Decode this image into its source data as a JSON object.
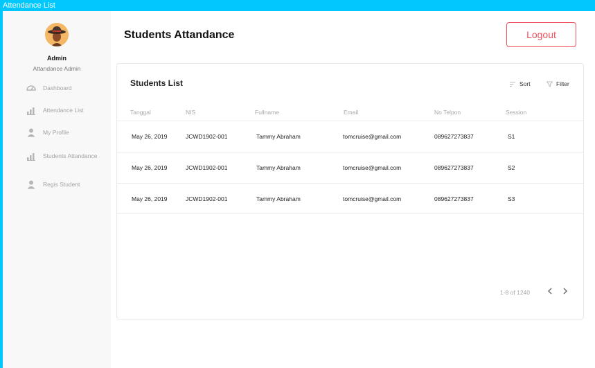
{
  "window": {
    "title": "Attendance List"
  },
  "sidebar": {
    "user": {
      "name": "Admin",
      "role": "Attandance Admin"
    },
    "items": [
      {
        "label": "Dashboard",
        "icon": "dashboard-icon"
      },
      {
        "label": "Attendance List",
        "icon": "chart-icon"
      },
      {
        "label": "My Profile",
        "icon": "user-icon"
      },
      {
        "label": "Students Attandance",
        "icon": "chart-icon"
      },
      {
        "label": "Regis Student",
        "icon": "user-icon"
      }
    ]
  },
  "header": {
    "title": "Students Attandance",
    "logout_label": "Logout"
  },
  "card": {
    "title": "Students List",
    "sort_label": "Sort",
    "filter_label": "Filter",
    "columns": [
      "Tanggal",
      "NIS",
      "Fullname",
      "Email",
      "No Telpon",
      "Session"
    ],
    "rows": [
      [
        "May 26, 2019",
        "JCWD1902-001",
        "Tammy Abraham",
        "tomcruise@gmail.com",
        "089627273837",
        "S1"
      ],
      [
        "May 26, 2019",
        "JCWD1902-001",
        "Tammy Abraham",
        "tomcruise@gmail.com",
        "089627273837",
        "S2"
      ],
      [
        "May 26, 2019",
        "JCWD1902-001",
        "Tammy Abraham",
        "tomcruise@gmail.com",
        "089627273837",
        "S3"
      ]
    ],
    "pagination": {
      "range": "1-8 of 1240"
    }
  },
  "colors": {
    "accent": "#f0515f",
    "titlebar": "#00c8ff",
    "sidebar_bg": "#f8f8f8"
  }
}
